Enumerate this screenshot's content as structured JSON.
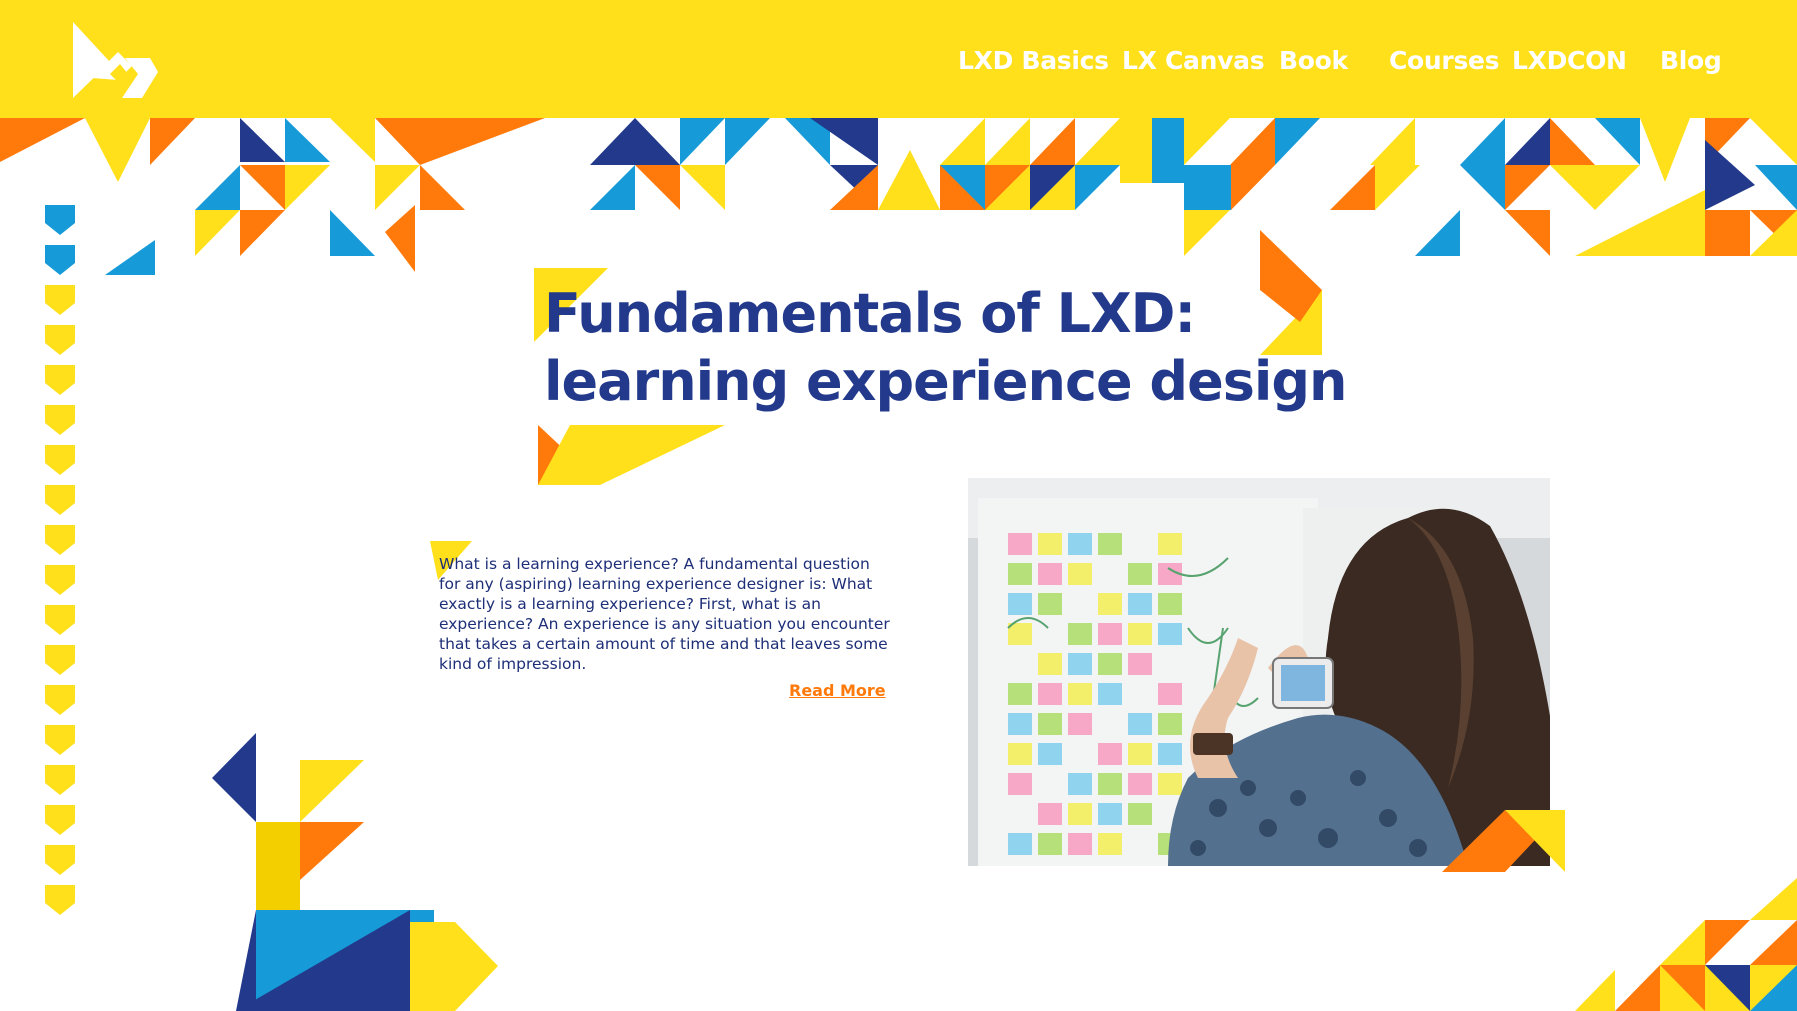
{
  "brand": {
    "logo_icon": "lxd-arrow-logo-icon"
  },
  "nav": {
    "items": [
      {
        "label": "LXD Basics"
      },
      {
        "label": "LX Canvas"
      },
      {
        "label": "Book"
      },
      {
        "label": "Courses"
      },
      {
        "label": "LXDCON"
      },
      {
        "label": "Blog"
      }
    ]
  },
  "hero": {
    "title_line1": "Fundamentals of LXD:",
    "title_line2": "learning experience design"
  },
  "article": {
    "excerpt": "What is a learning experience? A fundamental question for any (aspiring) learning experience designer is: What exactly is a learning experience? First, what is an experience? An experience is any situation you encounter that takes a certain amount of time and that leaves some kind of impression.",
    "read_more": "Read More",
    "image_icon": "photo-woman-photographing-sticky-notes"
  },
  "colors": {
    "yellow": "#ffe01b",
    "navy": "#233a8c",
    "blue": "#169bd8",
    "orange": "#ff7a0b",
    "text": "#1e2f78"
  }
}
